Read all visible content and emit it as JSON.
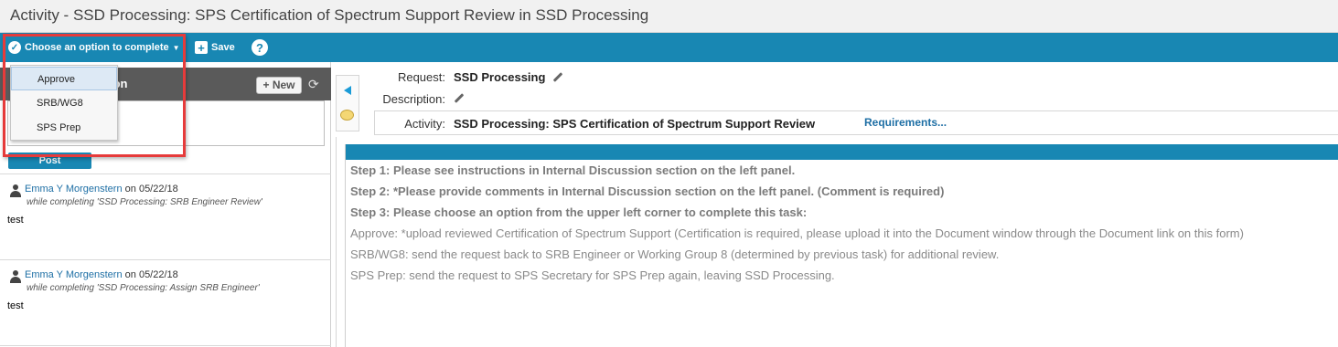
{
  "window": {
    "title": "Activity - SSD Processing: SPS Certification of Spectrum Support Review in SSD Processing"
  },
  "toolbar": {
    "choose_label": "Choose an option to complete",
    "save_label": "Save",
    "help_label": "?"
  },
  "dropdown": {
    "options": [
      {
        "label": "Approve",
        "highlighted": true
      },
      {
        "label": "SRB/WG8",
        "highlighted": false
      },
      {
        "label": "SPS Prep",
        "highlighted": false
      }
    ]
  },
  "discussion": {
    "header_visible_text": "ion",
    "new_button": "+ New",
    "post_button": "Post",
    "entries": [
      {
        "author": "Emma Y Morgenstern",
        "date_text": "on 05/22/18",
        "context": "while completing 'SSD Processing: SRB Engineer Review'",
        "body": "test"
      },
      {
        "author": "Emma Y Morgenstern",
        "date_text": "on 05/22/18",
        "context": "while completing 'SSD Processing: Assign SRB Engineer'",
        "body": "test"
      }
    ]
  },
  "form": {
    "request_label": "Request:",
    "request_value": "SSD Processing",
    "description_label": "Description:",
    "activity_label": "Activity:",
    "activity_value": "SSD Processing: SPS Certification of Spectrum Support Review",
    "requirements_link": "Requirements..."
  },
  "instructions": [
    {
      "text": "Step 1: Please see instructions in Internal Discussion section on the left panel.",
      "bold": true
    },
    {
      "text": "Step 2: *Please provide comments in Internal Discussion section on the left panel. (Comment is required)",
      "bold": true
    },
    {
      "text": "Step 3: Please choose an option from the upper left corner to complete this task:",
      "bold": true
    },
    {
      "text": "Approve: *upload reviewed Certification of Spectrum Support (Certification is required, please upload it into the Document window through the Document link on this form)",
      "bold": false
    },
    {
      "text": "SRB/WG8: send the request back to SRB Engineer or Working Group 8 (determined by previous task) for additional review.",
      "bold": false
    },
    {
      "text": "SPS Prep: send the request to SPS Secretary for SPS Prep again, leaving SSD Processing.",
      "bold": false
    }
  ],
  "colors": {
    "toolbar": "#1887b3",
    "link": "#1e6fa5",
    "highlight_frame": "#e63b3b",
    "discussion_header": "#5a5a5a"
  }
}
